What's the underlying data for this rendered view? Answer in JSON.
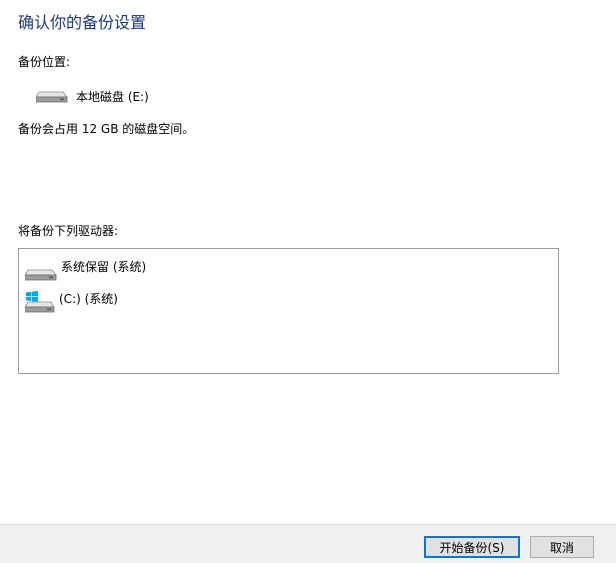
{
  "dialog": {
    "title": "确认你的备份设置"
  },
  "backup_location": {
    "label": "备份位置:",
    "drive_name": "本地磁盘 (E:)",
    "drive_icon": "hard-drive-icon"
  },
  "space_info": "备份会占用 12 GB 的磁盘空间。",
  "drive_list": {
    "label": "将备份下列驱动器:",
    "items": [
      {
        "name": "系统保留 (系统)",
        "icon": "hard-drive-icon"
      },
      {
        "name": "(C:) (系统)",
        "icon": "windows-drive-icon"
      }
    ]
  },
  "buttons": {
    "start": "开始备份(S)",
    "cancel": "取消"
  },
  "colors": {
    "title": "#1f3a78",
    "footer_bg": "#f0f0f0",
    "accent": "#0078d7",
    "windows_logo": "#00a4ef"
  }
}
